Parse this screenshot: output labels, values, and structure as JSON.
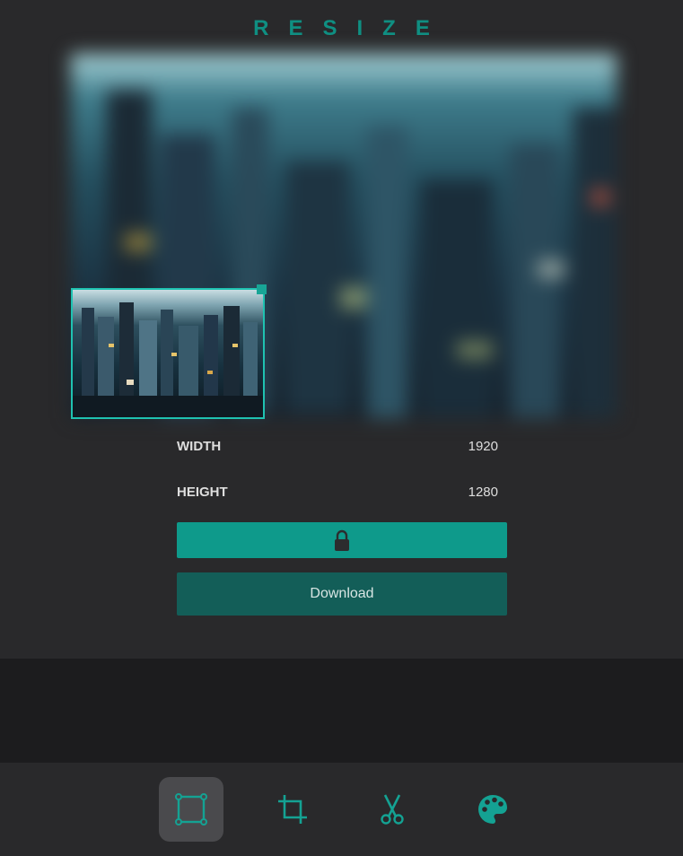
{
  "header": {
    "title": "RESIZE"
  },
  "image": {
    "alt": "city skyline aerial view"
  },
  "dimensions": {
    "width_label": "WIDTH",
    "width_value": "1920",
    "height_label": "HEIGHT",
    "height_value": "1280"
  },
  "buttons": {
    "lock_icon": "lock-icon",
    "download_label": "Download"
  },
  "toolbar": {
    "tools": [
      {
        "name": "resize",
        "icon": "resize-icon",
        "active": true
      },
      {
        "name": "crop",
        "icon": "crop-icon",
        "active": false
      },
      {
        "name": "cut",
        "icon": "scissors-icon",
        "active": false
      },
      {
        "name": "filters",
        "icon": "palette-icon",
        "active": false
      }
    ]
  },
  "colors": {
    "accent": "#0e9a8b",
    "accent_dark": "#135e58",
    "title": "#0f8f82",
    "panel": "#29292b",
    "background": "#1c1c1e"
  }
}
